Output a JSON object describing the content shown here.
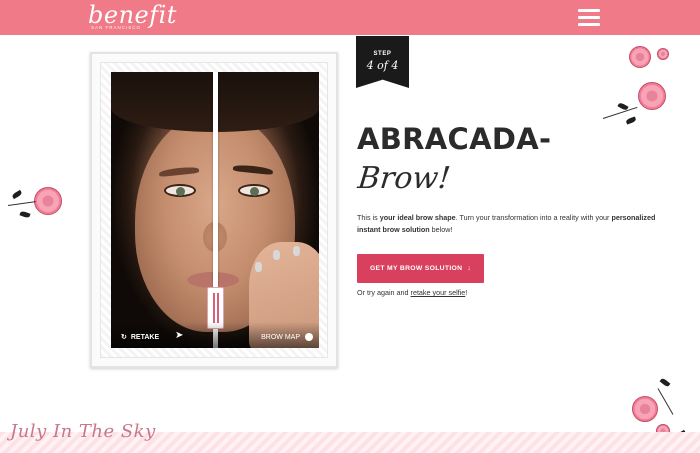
{
  "header": {
    "logo_text": "benefit",
    "logo_subtext": "SAN FRANCISCO",
    "menu_icon": "hamburger-menu-icon",
    "bg_color": "#f07a87"
  },
  "step_badge": {
    "label": "STEP",
    "value": "4 of 4"
  },
  "photo_controls": {
    "retake_label": "RETAKE",
    "retake_icon": "refresh-icon",
    "share_icon": "share-icon",
    "brow_map_label": "BROW MAP"
  },
  "headline": {
    "line1": "ABRACADA-",
    "line2": "Brow!"
  },
  "description": {
    "part1": "This is ",
    "bold1": "your ideal brow shape",
    "part2": ". Turn your transformation into a reality with your ",
    "bold2": "personalized instant brow solution",
    "part3": " below!"
  },
  "cta": {
    "label": "GET MY BROW SOLUTION",
    "icon": "arrow-down-icon",
    "color": "#d8405e"
  },
  "retry": {
    "prefix": "Or try again and ",
    "link": "retake your selfie",
    "suffix": "!"
  },
  "watermark": "July In The Sky"
}
